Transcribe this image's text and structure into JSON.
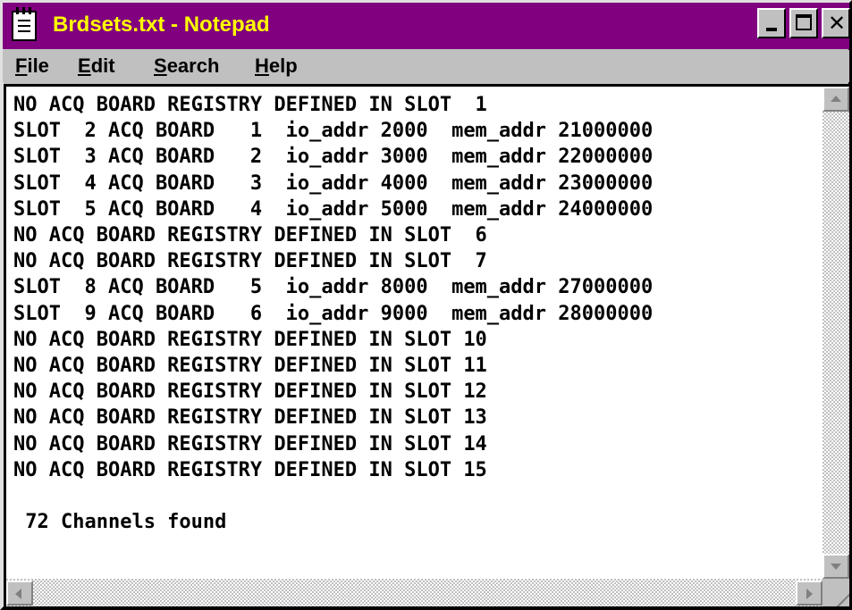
{
  "window": {
    "title": "Brdsets.txt - Notepad",
    "title_color": "#ffff00",
    "titlebar_color": "#800080",
    "icon": "notepad-icon",
    "controls": {
      "minimize_icon": "minimize-icon",
      "maximize_icon": "maximize-icon",
      "close_icon": "close-icon",
      "close_glyph": "✕"
    }
  },
  "menu": {
    "items": [
      {
        "accel": "F",
        "rest": "ile"
      },
      {
        "accel": "E",
        "rest": "dit"
      },
      {
        "accel": "S",
        "rest": "earch"
      },
      {
        "accel": "H",
        "rest": "elp"
      }
    ]
  },
  "editor": {
    "lines": [
      "NO ACQ BOARD REGISTRY DEFINED IN SLOT  1",
      "SLOT  2 ACQ BOARD   1  io_addr 2000  mem_addr 21000000",
      "SLOT  3 ACQ BOARD   2  io_addr 3000  mem_addr 22000000",
      "SLOT  4 ACQ BOARD   3  io_addr 4000  mem_addr 23000000",
      "SLOT  5 ACQ BOARD   4  io_addr 5000  mem_addr 24000000",
      "NO ACQ BOARD REGISTRY DEFINED IN SLOT  6",
      "NO ACQ BOARD REGISTRY DEFINED IN SLOT  7",
      "SLOT  8 ACQ BOARD   5  io_addr 8000  mem_addr 27000000",
      "SLOT  9 ACQ BOARD   6  io_addr 9000  mem_addr 28000000",
      "NO ACQ BOARD REGISTRY DEFINED IN SLOT 10",
      "NO ACQ BOARD REGISTRY DEFINED IN SLOT 11",
      "NO ACQ BOARD REGISTRY DEFINED IN SLOT 12",
      "NO ACQ BOARD REGISTRY DEFINED IN SLOT 13",
      "NO ACQ BOARD REGISTRY DEFINED IN SLOT 14",
      "NO ACQ BOARD REGISTRY DEFINED IN SLOT 15",
      "",
      " 72 Channels found"
    ]
  },
  "scrollbars": {
    "up_icon": "scroll-up-arrow-icon",
    "down_icon": "scroll-down-arrow-icon",
    "left_icon": "scroll-left-arrow-icon",
    "right_icon": "scroll-right-arrow-icon",
    "grip_icon": "resize-grip-icon"
  }
}
